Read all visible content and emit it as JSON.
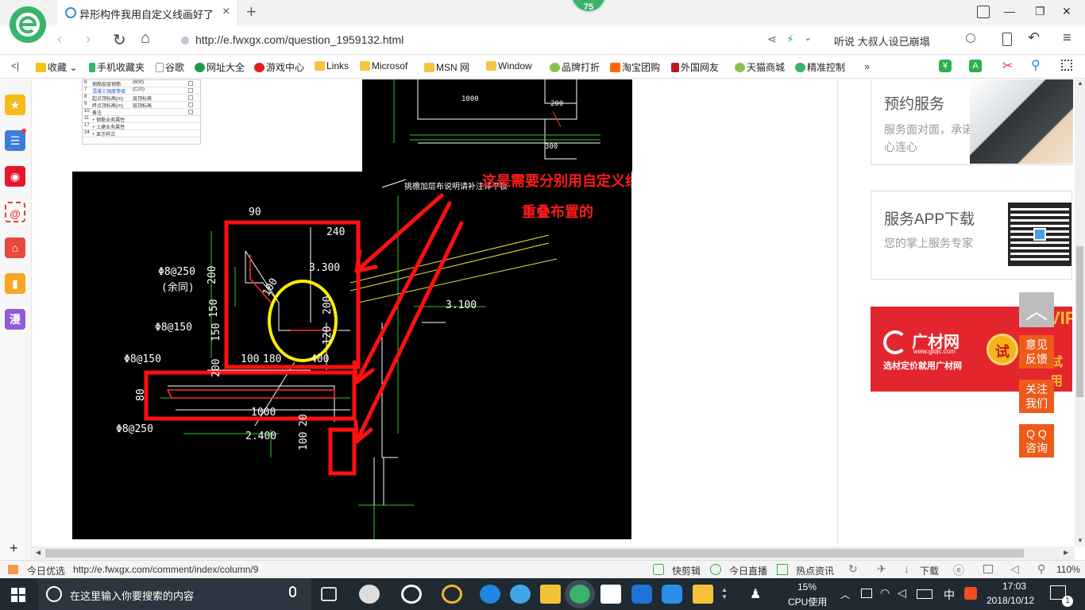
{
  "badge": {
    "value": "75"
  },
  "tab": {
    "title": "异形构件我用自定义线画好了。(",
    "close": "×",
    "new_tab": "+"
  },
  "window_controls": {
    "minimize": "—",
    "restore": "❐",
    "close": "✕"
  },
  "address": {
    "url": "http://e.fwxgx.com/question_1959132.html",
    "search_hint": "听说 大叔人设已崩塌"
  },
  "favorites": {
    "collapse": "<|",
    "items": [
      "收藏",
      "手机收藏夹",
      "谷歌",
      "网址大全",
      "游戏中心",
      "Links",
      "Microsof",
      "MSN 网",
      "Window",
      "品牌打折",
      "淘宝团购",
      "外国网友",
      "天猫商城",
      "精准控制"
    ],
    "more": "»"
  },
  "sidebar": {
    "icons": [
      "star-icon",
      "list-icon",
      "weibo-icon",
      "mail-icon",
      "game-icon",
      "bookmark-icon",
      "comic-icon"
    ],
    "comic_label": "漫",
    "add": "+"
  },
  "properties_table": {
    "rows": [
      {
        "num": "6",
        "name": "钢筋层层钢筋",
        "value": "(600)"
      },
      {
        "num": "7",
        "name": "混凝土强度等级",
        "value": "(C20)"
      },
      {
        "num": "8",
        "name": "起点顶标高(m)",
        "value": "层顶标高"
      },
      {
        "num": "9",
        "name": "终点顶标高(m)",
        "value": "层顶标高"
      },
      {
        "num": "10",
        "name": "备注",
        "value": ""
      },
      {
        "num": "11",
        "name": "+ 钢筋业务属性",
        "value": ""
      },
      {
        "num": "17",
        "name": "+ 土建业务属性",
        "value": ""
      },
      {
        "num": "24",
        "name": "+ 显示样式",
        "value": ""
      }
    ]
  },
  "cad_top": {
    "dim1": "1000",
    "dim2": "200",
    "dim3": "300"
  },
  "cad": {
    "title_note": "挑檐加层布说明请补注详平板",
    "annotation_line1": "这是需要分别用自定义线定义的，否则布置和框架梁",
    "annotation_line2": "重叠布置的",
    "labels": [
      "90",
      "240",
      "Φ8@250",
      "(余同)",
      "200",
      "3.300",
      "100",
      "150",
      "200",
      "120",
      "Φ8@150",
      "150",
      "100",
      "180",
      "400",
      "3.100",
      "Φ8@150",
      "200",
      "80",
      "1000",
      "Φ8@250",
      "2.400",
      "20",
      "100"
    ]
  },
  "right_panel": {
    "service_title": "预约服务",
    "service_desc": "服务面对面，承诺心连心",
    "app_title": "服务APP下载",
    "app_desc": "您的掌上服务专家",
    "ad_brand": "广材网",
    "ad_url": "www.gldjc.com",
    "ad_slogan": "选材定价就用广材网",
    "ad_try": "试",
    "ad_vip": "VIP",
    "ad_try2": "试用"
  },
  "float_buttons": {
    "top": "︿",
    "feedback": "意见反馈",
    "follow": "关注我们",
    "qq": "Q Q咨询"
  },
  "status": {
    "today": "今日优选",
    "url": "http://e.fwxgx.com/comment/index/column/9",
    "items": [
      "快剪辑",
      "今日直播",
      "热点资讯",
      "下载"
    ],
    "zoom": "110%"
  },
  "taskbar": {
    "search_placeholder": "在这里输入你要搜索的内容",
    "cpu_percent": "15%",
    "cpu_label": "CPU使用",
    "ime": "中",
    "time": "17:03",
    "date": "2018/10/12",
    "notif_count": "1"
  }
}
